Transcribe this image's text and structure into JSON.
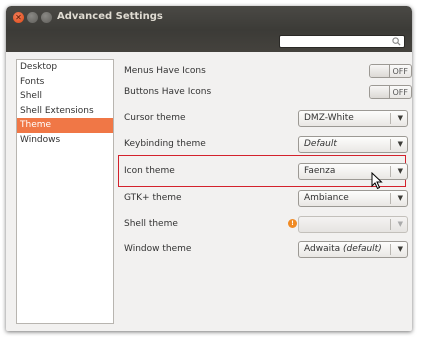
{
  "window": {
    "title": "Advanced Settings",
    "close_glyph": "✕"
  },
  "search": {
    "value": "",
    "placeholder": ""
  },
  "sidebar": {
    "items": [
      {
        "label": "Desktop"
      },
      {
        "label": "Fonts"
      },
      {
        "label": "Shell"
      },
      {
        "label": "Shell Extensions"
      },
      {
        "label": "Theme",
        "selected": true
      },
      {
        "label": "Windows"
      }
    ]
  },
  "settings": {
    "menus_have_icons": {
      "label": "Menus Have Icons",
      "state": "OFF"
    },
    "buttons_have_icons": {
      "label": "Buttons Have Icons",
      "state": "OFF"
    },
    "cursor_theme": {
      "label": "Cursor theme",
      "value": "DMZ-White"
    },
    "keybinding_theme": {
      "label": "Keybinding theme",
      "value": "Default"
    },
    "icon_theme": {
      "label": "Icon theme",
      "value": "Faenza"
    },
    "gtk_theme": {
      "label": "GTK+ theme",
      "value": "Ambiance"
    },
    "shell_theme": {
      "label": "Shell theme",
      "value": "",
      "warning_glyph": "!"
    },
    "window_theme": {
      "label": "Window theme",
      "value": "Adwaita",
      "suffix": "(default)"
    }
  },
  "colors": {
    "accent": "#f07746",
    "highlight_border": "#d3212c",
    "titlebar": "#3c3b37"
  },
  "icons": {
    "dropdown": "▼",
    "search": "search-icon"
  }
}
